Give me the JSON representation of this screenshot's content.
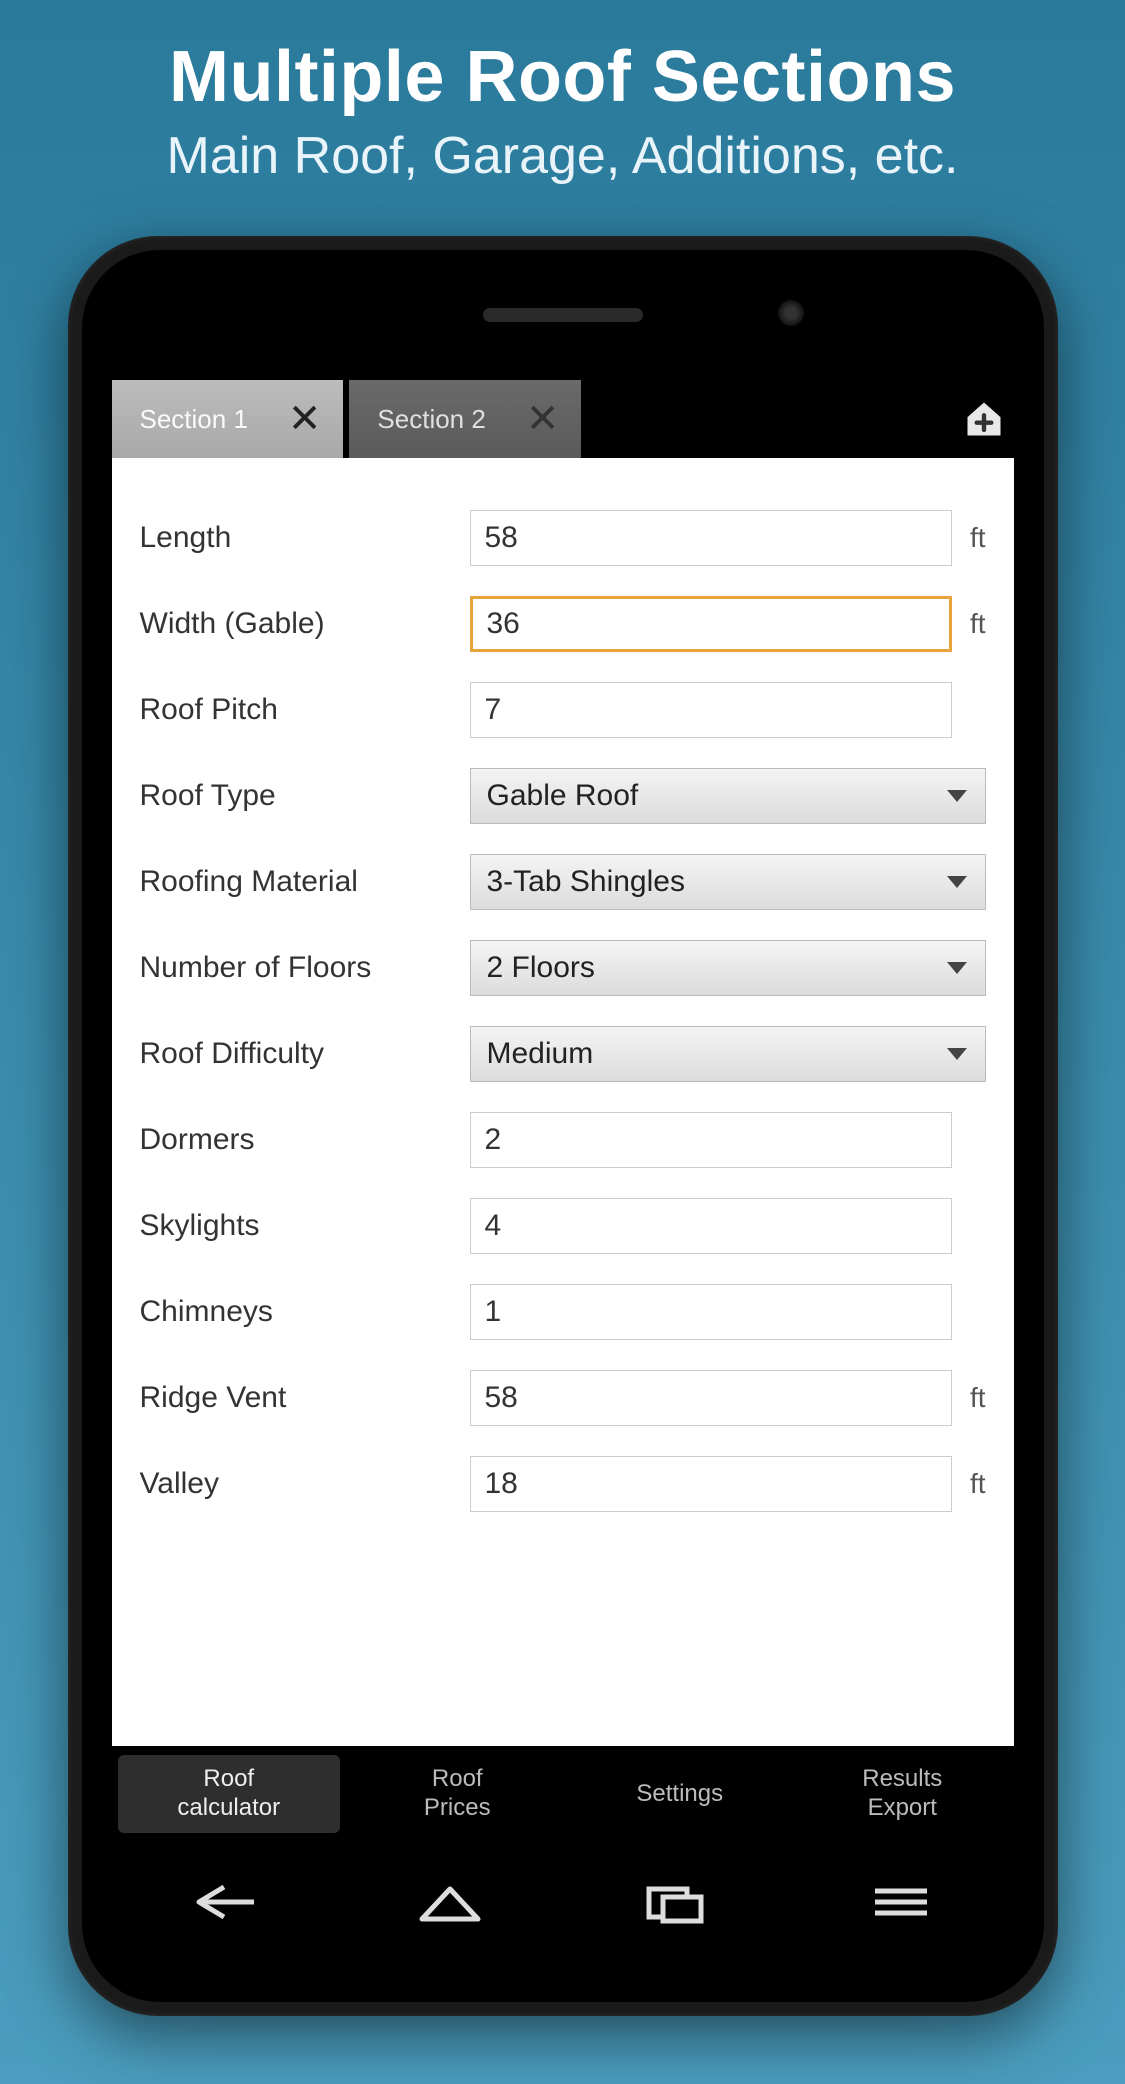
{
  "promo": {
    "title": "Multiple Roof Sections",
    "subtitle": "Main Roof, Garage, Additions, etc."
  },
  "tabs": [
    {
      "label": "Section 1",
      "active": true
    },
    {
      "label": "Section 2",
      "active": false
    }
  ],
  "form": {
    "length": {
      "label": "Length",
      "value": "58",
      "unit": "ft"
    },
    "width": {
      "label": "Width (Gable)",
      "value": "36",
      "unit": "ft"
    },
    "pitch": {
      "label": "Roof Pitch",
      "value": "7"
    },
    "roof_type": {
      "label": "Roof Type",
      "value": "Gable Roof"
    },
    "material": {
      "label": "Roofing Material",
      "value": "3-Tab Shingles"
    },
    "floors": {
      "label": "Number of Floors",
      "value": "2 Floors"
    },
    "difficulty": {
      "label": "Roof Difficulty",
      "value": "Medium"
    },
    "dormers": {
      "label": "Dormers",
      "value": "2"
    },
    "skylights": {
      "label": "Skylights",
      "value": "4"
    },
    "chimneys": {
      "label": "Chimneys",
      "value": "1"
    },
    "ridge_vent": {
      "label": "Ridge Vent",
      "value": "58",
      "unit": "ft"
    },
    "valley": {
      "label": "Valley",
      "value": "18",
      "unit": "ft"
    }
  },
  "bottomnav": [
    {
      "line1": "Roof",
      "line2": "calculator",
      "active": true
    },
    {
      "line1": "Roof",
      "line2": "Prices",
      "active": false
    },
    {
      "line1": "Settings",
      "line2": "",
      "active": false
    },
    {
      "line1": "Results",
      "line2": "Export",
      "active": false
    }
  ]
}
